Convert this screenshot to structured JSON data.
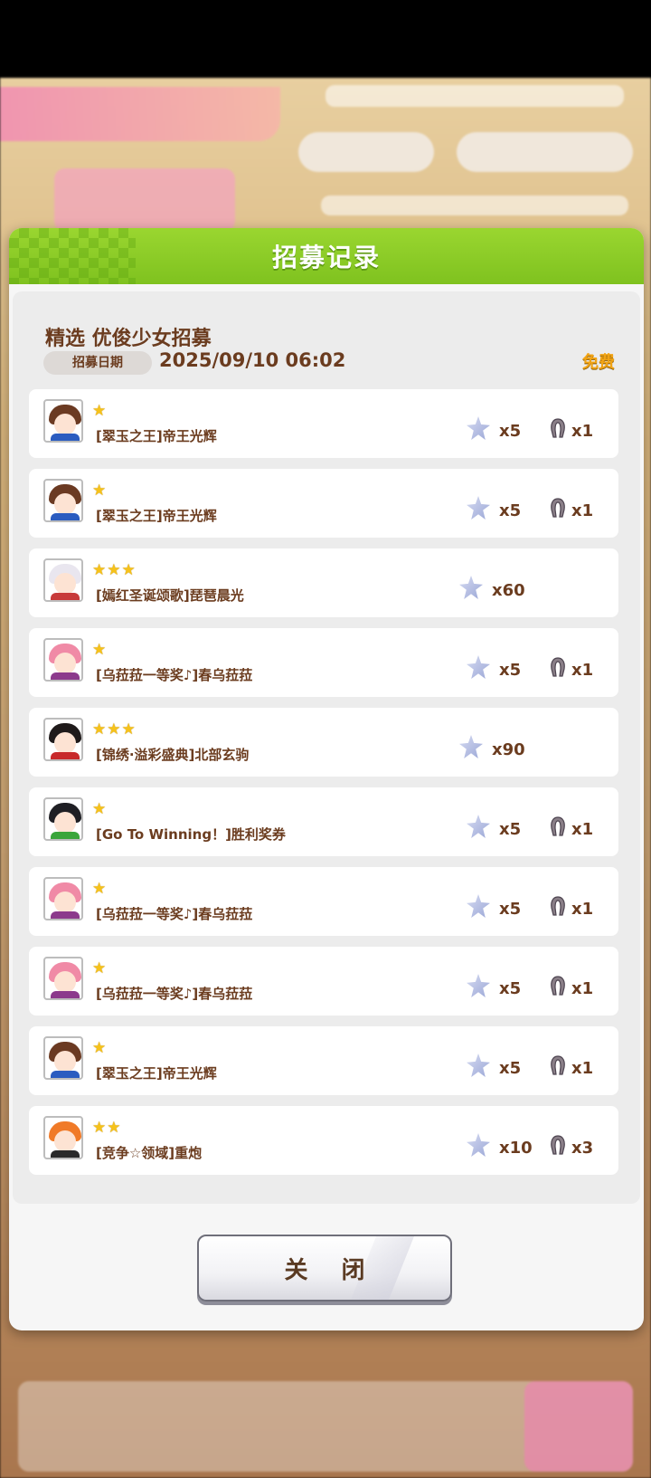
{
  "dialog": {
    "title": "招募记录",
    "banner_name": "精选 优俊少女招募",
    "date_label": "招募日期",
    "date_value": "2025/09/10 06:02",
    "cost_tag": "免费",
    "close_label": "关 闭"
  },
  "records": [
    {
      "stars": "★",
      "name": "[翠玉之王]帝王光辉",
      "piece_qty": "x5",
      "shoe_qty": "x1",
      "hair": "#6b3a22",
      "accent": "#2b5cc0"
    },
    {
      "stars": "★",
      "name": "[翠玉之王]帝王光辉",
      "piece_qty": "x5",
      "shoe_qty": "x1",
      "hair": "#6b3a22",
      "accent": "#2b5cc0"
    },
    {
      "stars": "★★★",
      "name": "[嫣红圣诞颂歌]琵琶晨光",
      "piece_qty": "x60",
      "shoe_qty": "",
      "hair": "#e9e6ef",
      "accent": "#c83a3a"
    },
    {
      "stars": "★",
      "name": "[乌菈菈一等奖♪]春乌菈菈",
      "piece_qty": "x5",
      "shoe_qty": "x1",
      "hair": "#f08aa6",
      "accent": "#8c3a8c"
    },
    {
      "stars": "★★★",
      "name": "[锦绣·溢彩盛典]北部玄驹",
      "piece_qty": "x90",
      "shoe_qty": "",
      "hair": "#1f1a1a",
      "accent": "#c8292a"
    },
    {
      "stars": "★",
      "name": "[Go To Winning！]胜利奖券",
      "piece_qty": "x5",
      "shoe_qty": "x1",
      "hair": "#1f1f24",
      "accent": "#3aa53a"
    },
    {
      "stars": "★",
      "name": "[乌菈菈一等奖♪]春乌菈菈",
      "piece_qty": "x5",
      "shoe_qty": "x1",
      "hair": "#f08aa6",
      "accent": "#8c3a8c"
    },
    {
      "stars": "★",
      "name": "[乌菈菈一等奖♪]春乌菈菈",
      "piece_qty": "x5",
      "shoe_qty": "x1",
      "hair": "#f08aa6",
      "accent": "#8c3a8c"
    },
    {
      "stars": "★",
      "name": "[翠玉之王]帝王光辉",
      "piece_qty": "x5",
      "shoe_qty": "x1",
      "hair": "#6b3a22",
      "accent": "#2b5cc0"
    },
    {
      "stars": "★★",
      "name": "[竞争☆领域]重炮",
      "piece_qty": "x10",
      "shoe_qty": "x3",
      "hair": "#f07a28",
      "accent": "#2a2a2a"
    }
  ],
  "colors": {
    "header_green": "#8ccc26",
    "text_brown": "#6b3c1f",
    "star_gold": "#f6c21a",
    "free_orange": "#f2a415"
  },
  "icons": {
    "piece": "character-piece-icon",
    "shoe": "horseshoe-icon"
  }
}
